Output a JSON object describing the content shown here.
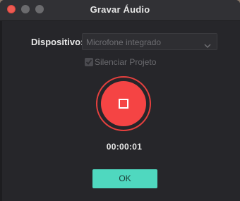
{
  "window": {
    "title": "Gravar Áudio"
  },
  "device": {
    "label": "Dispositivo:",
    "selected": "Microfone integrado"
  },
  "mute": {
    "label": "Silenciar Projeto",
    "checked": true
  },
  "recorder": {
    "elapsed": "00:00:01",
    "state": "recording"
  },
  "actions": {
    "ok_label": "OK"
  },
  "icons": {
    "close": "close-icon",
    "minimize": "minimize-icon",
    "maximize": "maximize-icon",
    "dropdown": "chevron-down-icon",
    "check": "checkmark-icon",
    "stop": "stop-icon"
  },
  "colors": {
    "record_red": "#f54444",
    "accent_teal": "#4fd8bf",
    "background": "#26262a"
  }
}
